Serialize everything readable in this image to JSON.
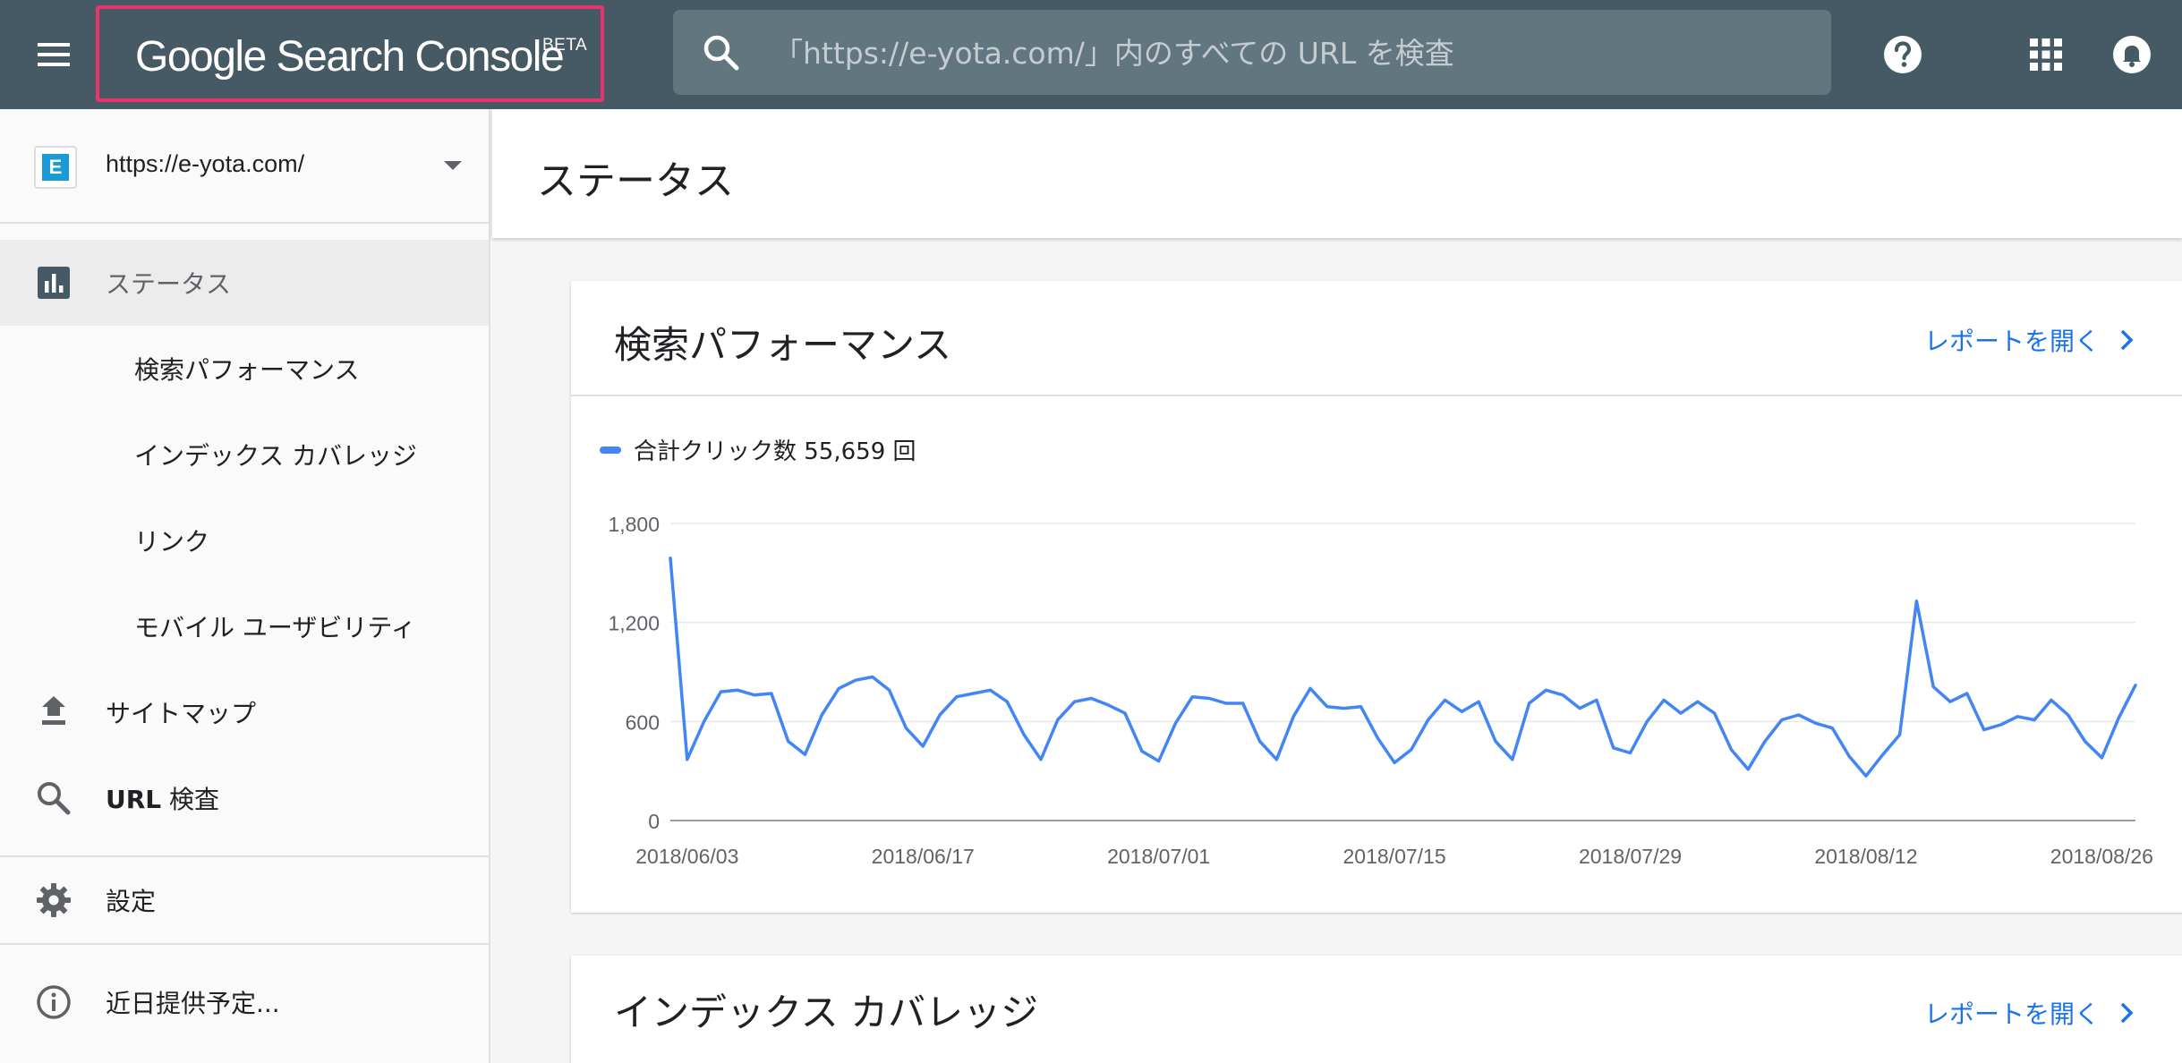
{
  "topbar": {
    "logo_text": "Google Search Console",
    "logo_badge": "BETA",
    "search_placeholder": "「https://e-yota.com/」内のすべての URL を検査",
    "icons": [
      "menu-icon",
      "search-icon",
      "help-icon",
      "apps-icon",
      "notifications-icon"
    ]
  },
  "sidebar": {
    "property_url": "https://e-yota.com/",
    "property_favicon_letter": "E",
    "items": [
      {
        "label": "ステータス",
        "icon": "bar-chart-icon",
        "active": true
      },
      {
        "label": "検索パフォーマンス"
      },
      {
        "label": "インデックス カバレッジ"
      },
      {
        "label": "リンク"
      },
      {
        "label": "モバイル ユーザビリティ"
      },
      {
        "label": "サイトマップ",
        "icon": "upload-icon"
      },
      {
        "label_prefix": "URL",
        "label_suffix": " 検査",
        "icon": "search-icon"
      },
      {
        "label": "設定",
        "icon": "gear-icon"
      },
      {
        "label": "近日提供予定...",
        "icon": "info-icon"
      }
    ]
  },
  "main": {
    "page_title": "ステータス",
    "cards": [
      {
        "title": "検索パフォーマンス",
        "link": "レポートを開く"
      },
      {
        "title": "インデックス カバレッジ",
        "link": "レポートを開く"
      }
    ]
  },
  "colors": {
    "topbar": "#455a64",
    "search_bg": "#627680",
    "accent_link": "#1a73e8",
    "series": "#4285f4",
    "logo_highlight": "#e8336d"
  },
  "chart_data": {
    "type": "line",
    "legend": "合計クリック数 55,659 回",
    "series": [
      {
        "name": "合計クリック数",
        "values": [
          1590,
          370,
          600,
          780,
          790,
          760,
          770,
          480,
          400,
          640,
          800,
          850,
          870,
          790,
          560,
          450,
          640,
          750,
          770,
          790,
          720,
          520,
          370,
          610,
          720,
          740,
          700,
          650,
          420,
          360,
          590,
          750,
          740,
          710,
          710,
          480,
          370,
          630,
          800,
          690,
          680,
          690,
          500,
          350,
          430,
          610,
          730,
          660,
          720,
          480,
          370,
          710,
          790,
          760,
          680,
          730,
          440,
          410,
          600,
          730,
          650,
          720,
          650,
          430,
          310,
          480,
          610,
          640,
          590,
          560,
          390,
          270,
          400,
          520,
          1330,
          810,
          720,
          770,
          550,
          580,
          630,
          610,
          730,
          640,
          480,
          380,
          620,
          820
        ]
      }
    ],
    "x_start": "2018/06/02",
    "x_end": "2018/08/28",
    "x_tick_labels": [
      "2018/06/03",
      "2018/06/17",
      "2018/07/01",
      "2018/07/15",
      "2018/07/29",
      "2018/08/12",
      "2018/08/26"
    ],
    "y_tick_labels": [
      "1,800",
      "1,200",
      "600",
      "0"
    ],
    "y_ticks": [
      1800,
      1200,
      600,
      0
    ],
    "ylim": [
      0,
      1800
    ],
    "grid": true
  }
}
